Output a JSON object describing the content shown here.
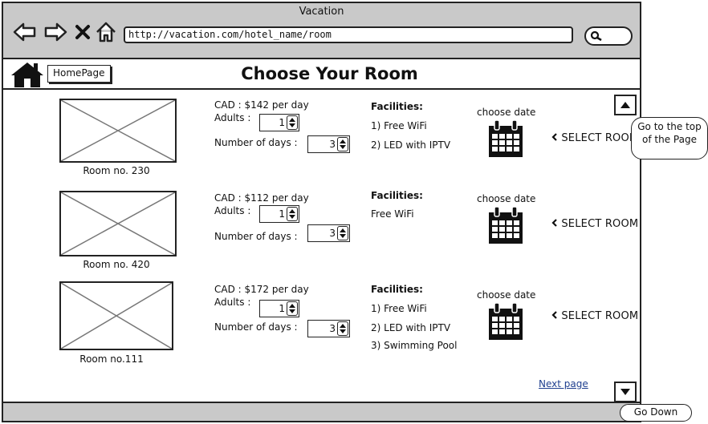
{
  "window": {
    "title": "Vacation"
  },
  "browser": {
    "url": "http://vacation.com/hotel_name/room"
  },
  "header": {
    "home_link": "HomePage",
    "title": "Choose Your Room"
  },
  "labels": {
    "adults": "Adults :",
    "days": "Number of days :",
    "facilities": "Facilities:",
    "choose_date": "choose date",
    "select_room": "SELECT ROOM"
  },
  "rooms": [
    {
      "name": "Room no. 230",
      "price": "CAD : $142 per day",
      "adults": "1",
      "days": "3",
      "facilities": [
        "1) Free WiFi",
        "2) LED with IPTV"
      ]
    },
    {
      "name": "Room no. 420",
      "price": "CAD : $112 per day",
      "adults": "1",
      "days": "3",
      "facilities": [
        "Free WiFi"
      ]
    },
    {
      "name": "Room no.111",
      "price": "CAD : $172 per day",
      "adults": "1",
      "days": "3",
      "facilities": [
        "1) Free WiFi",
        "2) LED with IPTV",
        "3) Swimming Pool"
      ]
    }
  ],
  "next_page": "Next page",
  "callouts": {
    "top": "Go to the top of the Page",
    "down": "Go Down"
  },
  "icons": [
    "back-arrow-icon",
    "forward-arrow-icon",
    "close-x-icon",
    "home-icon",
    "search-icon",
    "calendar-icon",
    "chevron-left-icon",
    "scroll-up-icon",
    "scroll-down-icon"
  ]
}
